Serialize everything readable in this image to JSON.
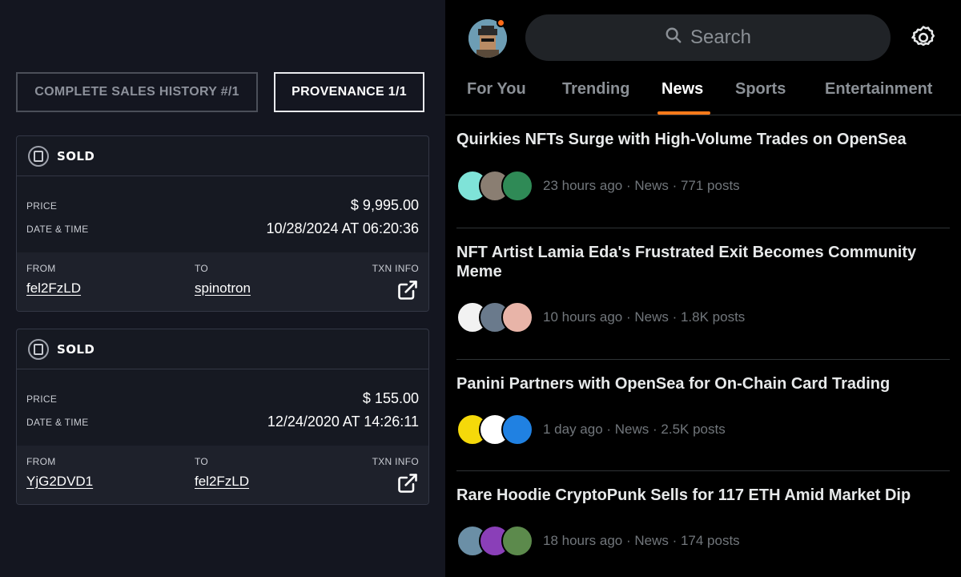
{
  "left": {
    "tabs": {
      "history": "COMPLETE SALES HISTORY #/1",
      "provenance": "PROVENANCE 1/1"
    },
    "sales": [
      {
        "status": "SOLD",
        "price_label": "PRICE",
        "price": "$ 9,995.00",
        "date_label": "DATE & TIME",
        "date": "10/28/2024 AT 06:20:36",
        "from_label": "FROM",
        "from": "fel2FzLD",
        "to_label": "TO",
        "to": "spinotron",
        "txn_label": "TXN INFO"
      },
      {
        "status": "SOLD",
        "price_label": "PRICE",
        "price": "$ 155.00",
        "date_label": "DATE & TIME",
        "date": "12/24/2020 AT 14:26:11",
        "from_label": "FROM",
        "from": "YjG2DVD1",
        "to_label": "TO",
        "to": "fel2FzLD",
        "txn_label": "TXN INFO"
      }
    ]
  },
  "right": {
    "search": {
      "placeholder": "Search"
    },
    "tabs": [
      "For You",
      "Trending",
      "News",
      "Sports",
      "Entertainment"
    ],
    "active_tab": "News",
    "accent": "#ff7a1a",
    "news": [
      {
        "headline": "Quirkies NFTs Surge with High-Volume Trades on OpenSea",
        "meta": "23 hours ago · News · 771 posts"
      },
      {
        "headline": "NFT Artist Lamia Eda's Frustrated Exit Becomes Community Meme",
        "meta": "10 hours ago · News · 1.8K posts"
      },
      {
        "headline": "Panini Partners with OpenSea for On-Chain Card Trading",
        "meta": "1 day ago · News · 2.5K posts"
      },
      {
        "headline": "Rare Hoodie CryptoPunk Sells for 117 ETH Amid Market Dip",
        "meta": "18 hours ago · News · 174 posts"
      }
    ]
  }
}
